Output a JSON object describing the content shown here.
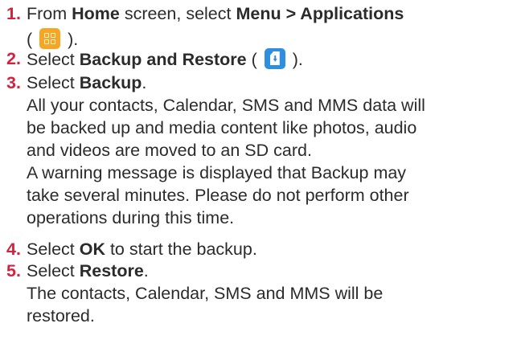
{
  "steps": [
    {
      "number": "1.",
      "lines": [
        {
          "a": "From ",
          "b": "Home",
          "c": " screen, select ",
          "d": "Menu > Applications"
        },
        {
          "open": "(",
          "close": ")."
        }
      ],
      "icon": "applications-icon"
    },
    {
      "number": "2.",
      "a": "Select ",
      "b": "Backup and Restore",
      "open": " (",
      "close": ").",
      "icon": "backup-restore-icon"
    },
    {
      "number": "3.",
      "a": "Select ",
      "b": "Backup",
      "c": ".",
      "desc": [
        "All your contacts, Calendar, SMS and MMS data will",
        "be backed up and media content like photos, audio",
        "and videos are moved to an SD card.",
        "A warning message is displayed that Backup may",
        "take several minutes. Please do not perform other",
        "operations during this time."
      ]
    },
    {
      "number": "4.",
      "a": "Select ",
      "b": "OK",
      "c": " to start the backup."
    },
    {
      "number": "5.",
      "a": "Select ",
      "b": "Restore",
      "c": ".",
      "desc": [
        "The contacts, Calendar, SMS and MMS will be",
        "restored."
      ]
    }
  ],
  "colors": {
    "step_number": "#d4213d",
    "text": "#2b2b2b",
    "applications_icon": "#f6a623",
    "backup_icon": "#2e8fe0"
  }
}
